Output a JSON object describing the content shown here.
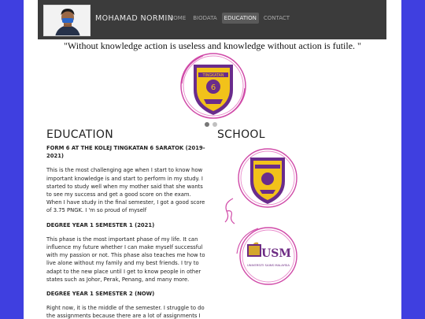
{
  "header": {
    "brand": "MOHAMAD NORMIN",
    "nav": [
      {
        "label": "HOME",
        "active": false
      },
      {
        "label": "BIODATA",
        "active": false
      },
      {
        "label": "EDUCATION",
        "active": true
      },
      {
        "label": "CONTACT",
        "active": false
      }
    ]
  },
  "quote": "\"Without knowledge action is useless and knowledge without action is futile. \"",
  "carousel": {
    "slide_count": 2,
    "active_index": 0
  },
  "crest": {
    "kolej_text": "TINGKATAN",
    "kolej_number": "6"
  },
  "education": {
    "title": "EDUCATION",
    "entries": [
      {
        "heading": " FORM 6 AT THE KOLEJ TINGKATAN 6 SARATOK (2019-2021)",
        "body": "This is the most challenging age when I start to know how important knowledge is and start to perform in my study. I started to study well when my mother said that she wants to see my success and get a good score on the exam. When I have study in the final semester, I got a good score of 3.75 PNGK. I 'm so proud of myself"
      },
      {
        "heading": "DEGREE YEAR 1 SEMESTER 1 (2021)",
        "body": "This phase is the most important phase of my life. It can influence my future whether I can make myself successful with my passion or not. This phase also teaches me how to live alone without my family and my best friends. I try to adapt to the new place until I get to know people in other states such as Johor, Perak, Penang, and many more."
      },
      {
        "heading": " DEGREE YEAR 1 SEMESTER 2 (NOW)",
        "body": "Right now, it is the middle of the semester. I struggle to do the assignments because there are a lot of assignments I need to submit early. I just made this thing complicated"
      }
    ]
  },
  "school": {
    "title": "SCHOOL",
    "logo_text": "USM",
    "logo_caption": "UNIVERSITI SAINS MALAYSIA"
  },
  "colors": {
    "page_bg": "#3f3fe0",
    "navbar": "#3b3b3b",
    "crest_ring": "#d04aa8",
    "crest_inner": "#6a2c8c",
    "crest_gold": "#f2c21a",
    "usm_purple": "#6d2b83",
    "usm_gold": "#d4a72c"
  }
}
